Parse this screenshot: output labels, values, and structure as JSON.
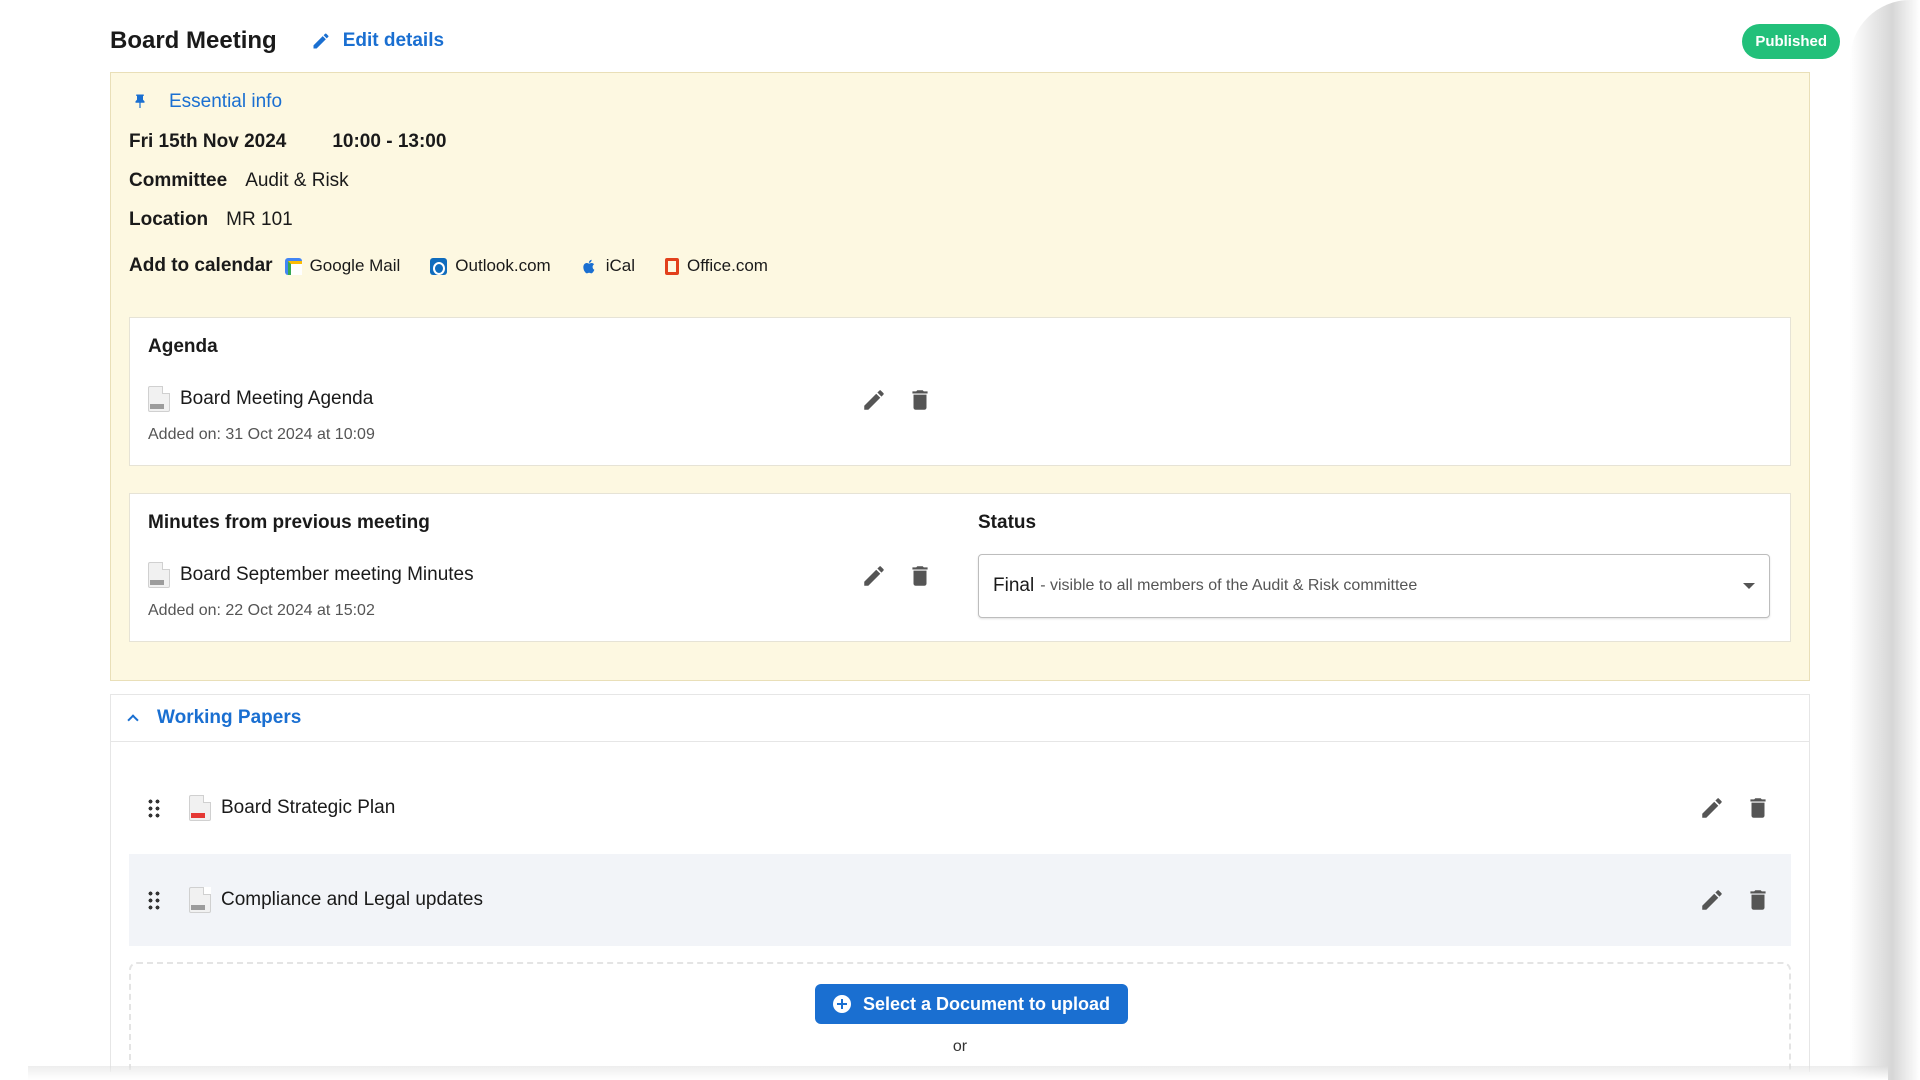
{
  "header": {
    "title": "Board Meeting",
    "edit_label": "Edit details",
    "status_badge": "Published"
  },
  "essential": {
    "heading": "Essential info",
    "date": "Fri 15th Nov 2024",
    "time": "10:00 - 13:00",
    "committee_label": "Committee",
    "committee_value": "Audit & Risk",
    "location_label": "Location",
    "location_value": "MR 101",
    "calendar_label": "Add to calendar",
    "calendars": [
      "Google Mail",
      "Outlook.com",
      "iCal",
      "Office.com"
    ]
  },
  "agenda": {
    "title": "Agenda",
    "doc_name": "Board Meeting Agenda",
    "added": "Added on: 31 Oct 2024 at 10:09"
  },
  "minutes": {
    "title": "Minutes from previous meeting",
    "doc_name": "Board September meeting Minutes",
    "added": "Added on: 22 Oct 2024 at 15:02",
    "status_title": "Status",
    "status_value": "Final",
    "status_desc": "- visible to all members of the Audit & Risk committee"
  },
  "working_papers": {
    "heading": "Working Papers",
    "items": [
      {
        "name": "Board Strategic Plan",
        "type": "pdf"
      },
      {
        "name": "Compliance and Legal updates",
        "type": "doc"
      }
    ],
    "upload_label": "Select a Document to upload",
    "or_label": "or"
  },
  "colors": {
    "accent": "#1a6fd1",
    "badge": "#22c07a",
    "panel": "#fdf8e1"
  }
}
